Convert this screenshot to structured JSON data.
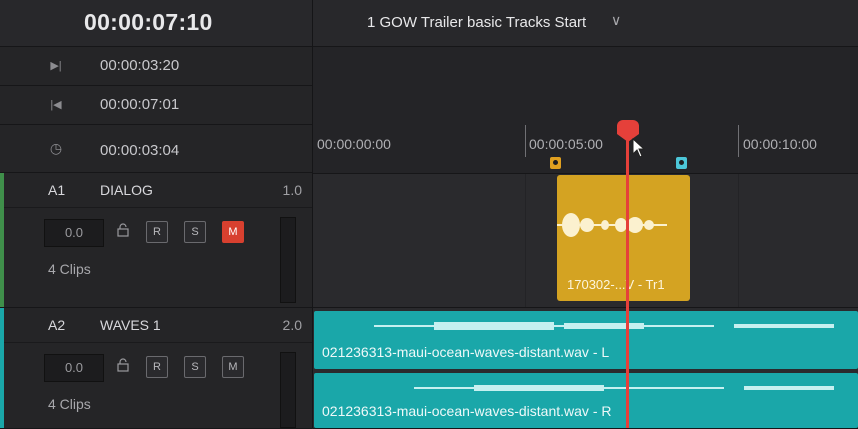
{
  "timecode": {
    "main": "00:00:07:10",
    "rows": [
      {
        "icon": "mark-in-icon",
        "glyph": "▶|",
        "value": "00:00:03:20"
      },
      {
        "icon": "mark-out-icon",
        "glyph": "|◀",
        "value": "00:00:07:01"
      },
      {
        "icon": "duration-clock-icon",
        "glyph": "◷",
        "value": "00:00:03:04"
      }
    ]
  },
  "timeline": {
    "title": "1 GOW Trailer basic Tracks Start",
    "chevron": "∨",
    "ruler": [
      "00:00:00:00",
      "00:00:05:00",
      "00:00:10:00"
    ]
  },
  "tracks": [
    {
      "id": "A1",
      "name": "DIALOG",
      "channels": "1.0",
      "volume": "0.0",
      "clips": "4 Clips",
      "color": "#3f8f4a",
      "mute_active": true
    },
    {
      "id": "A2",
      "name": "WAVES 1",
      "channels": "2.0",
      "volume": "0.0",
      "clips": "4 Clips",
      "color": "#1aa7a9",
      "mute_active": false
    }
  ],
  "buttons": {
    "record": "R",
    "solo": "S",
    "mute": "M"
  },
  "clips": {
    "dialog": "170302-...V - Tr1",
    "wave1": "021236313-maui-ocean-waves-distant.wav - L",
    "wave2": "021236313-maui-ocean-waves-distant.wav - R"
  },
  "colors": {
    "playhead": "#e5403a",
    "dialog_clip": "#d4a322",
    "wave_clip": "#1aa7a9",
    "marker_orange": "#e0a020",
    "marker_cyan": "#4cc6d8",
    "mute_active": "#d8402f"
  }
}
